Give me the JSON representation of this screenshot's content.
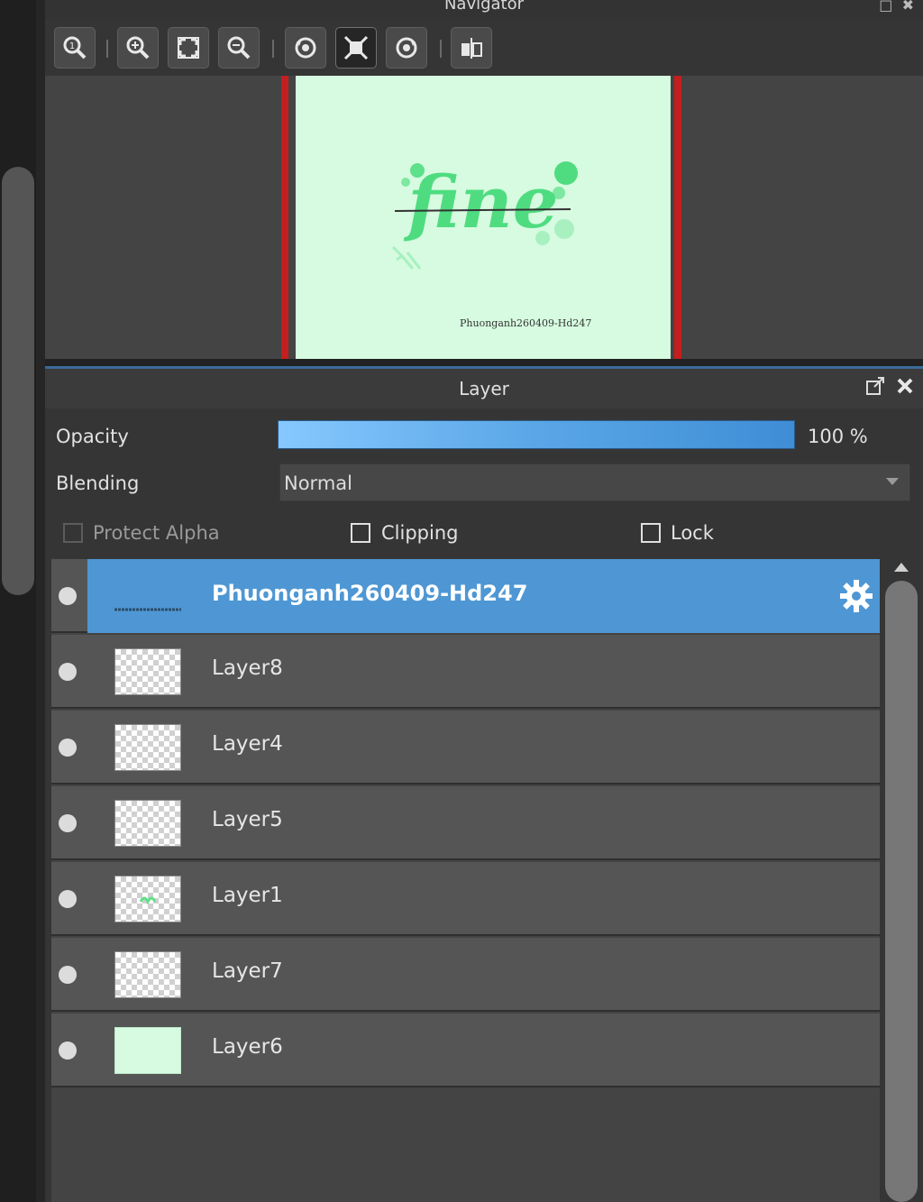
{
  "navigator": {
    "title": "Navigator",
    "toolbar": [
      "zoom-actual-icon",
      "zoom-in-icon",
      "fit-icon",
      "zoom-out-icon",
      "rotate-left-icon",
      "fullscreen-icon",
      "rotate-right-icon",
      "flip-icon"
    ],
    "canvas_preview": {
      "artwork_text": "fine",
      "signature": "Phuonganh260409-Hd247",
      "background": "#d6fbe0"
    }
  },
  "layer_panel": {
    "title": "Layer",
    "opacity": {
      "label": "Opacity",
      "value_text": "100 %",
      "value": 100
    },
    "blending": {
      "label": "Blending",
      "selected": "Normal"
    },
    "protect_alpha": {
      "label": "Protect Alpha",
      "checked": false,
      "enabled": false
    },
    "clipping": {
      "label": "Clipping",
      "checked": false
    },
    "lock": {
      "label": "Lock",
      "checked": false
    },
    "layers": [
      {
        "name": "Phuonganh260409-Hd247",
        "selected": true,
        "thumb": "text-line"
      },
      {
        "name": "Layer8",
        "selected": false,
        "thumb": "transparent"
      },
      {
        "name": "Layer4",
        "selected": false,
        "thumb": "transparent"
      },
      {
        "name": "Layer5",
        "selected": false,
        "thumb": "transparent"
      },
      {
        "name": "Layer1",
        "selected": false,
        "thumb": "transparent-green"
      },
      {
        "name": "Layer7",
        "selected": false,
        "thumb": "transparent"
      },
      {
        "name": "Layer6",
        "selected": false,
        "thumb": "mint"
      }
    ]
  },
  "colors": {
    "accent": "#4e97d4",
    "opacity_bar": "#5aa6e6",
    "canvas_border": "#c41e1e"
  }
}
